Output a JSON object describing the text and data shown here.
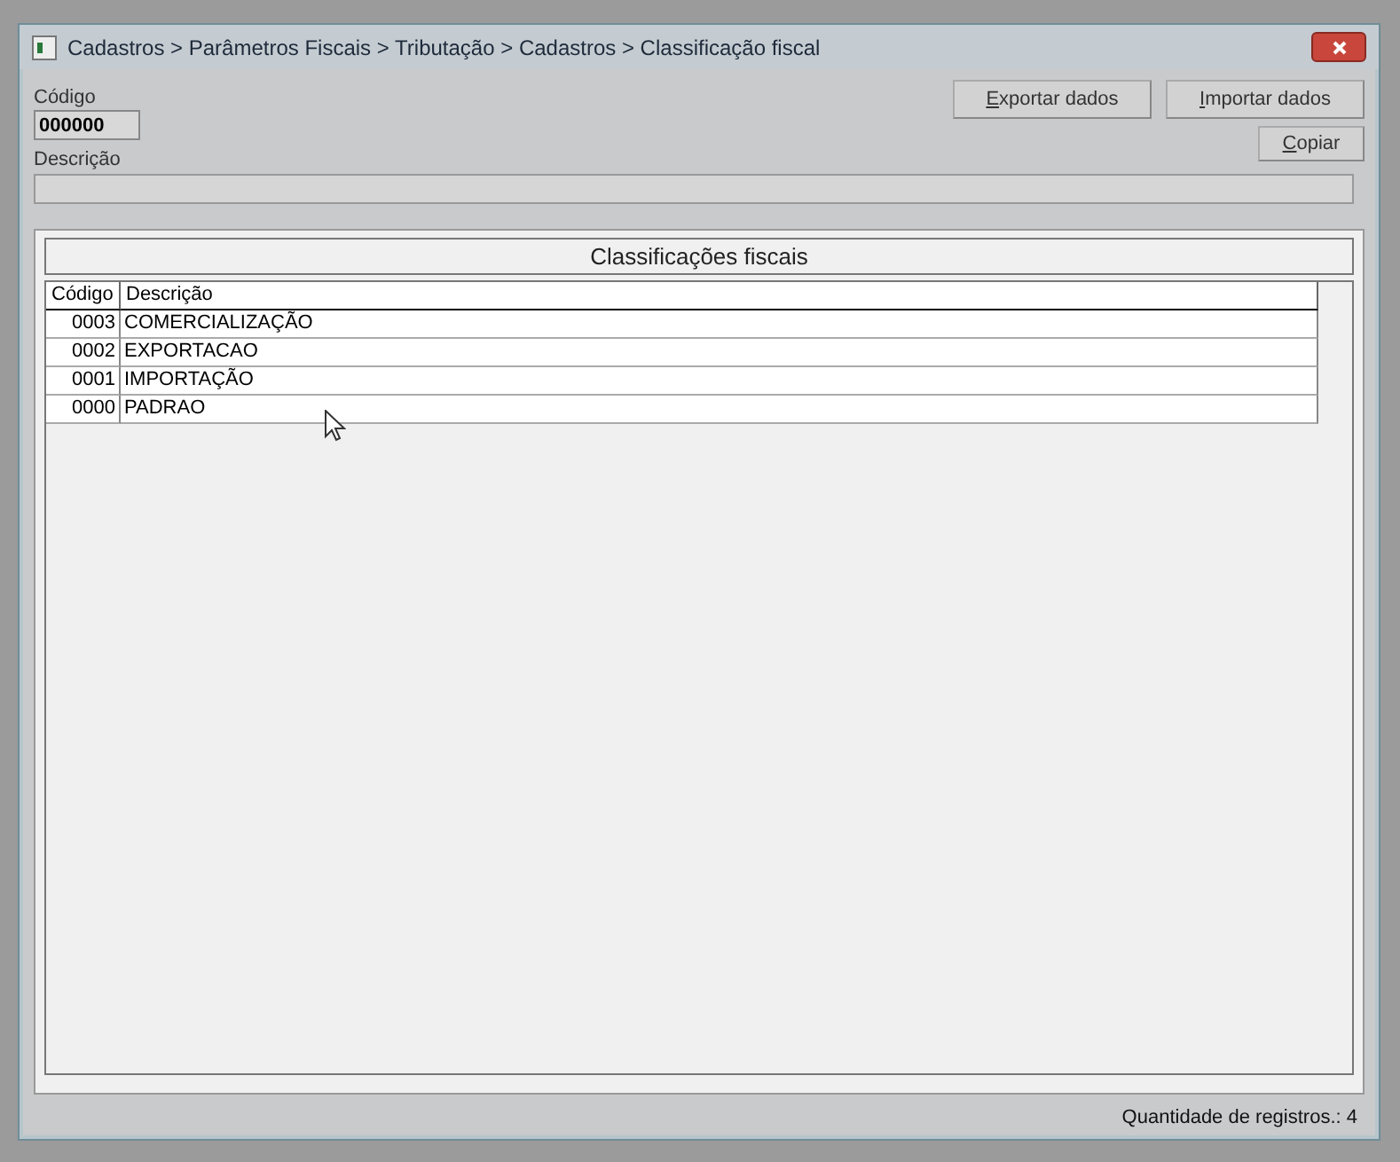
{
  "window": {
    "title": "Cadastros > Parâmetros Fiscais > Tributação > Cadastros > Classificação fiscal"
  },
  "form": {
    "code_label": "Código",
    "code_value": "000000",
    "description_label": "Descrição"
  },
  "buttons": [
    {
      "label": "Exportar dados"
    },
    {
      "label": "Importar dados"
    },
    {
      "label": "Copiar"
    }
  ],
  "group": {
    "title": "Classificações fiscais"
  },
  "table": {
    "columns": [
      "Código",
      "Descrição"
    ],
    "rows": [
      [
        "0003",
        "COMERCIALIZAÇÃO"
      ],
      [
        "0002",
        "EXPORTACAO"
      ],
      [
        "0001",
        "IMPORTAÇÃO"
      ],
      [
        "0000",
        "PADRAO"
      ]
    ]
  },
  "status_bar": "Quantidade de registros.: 4"
}
